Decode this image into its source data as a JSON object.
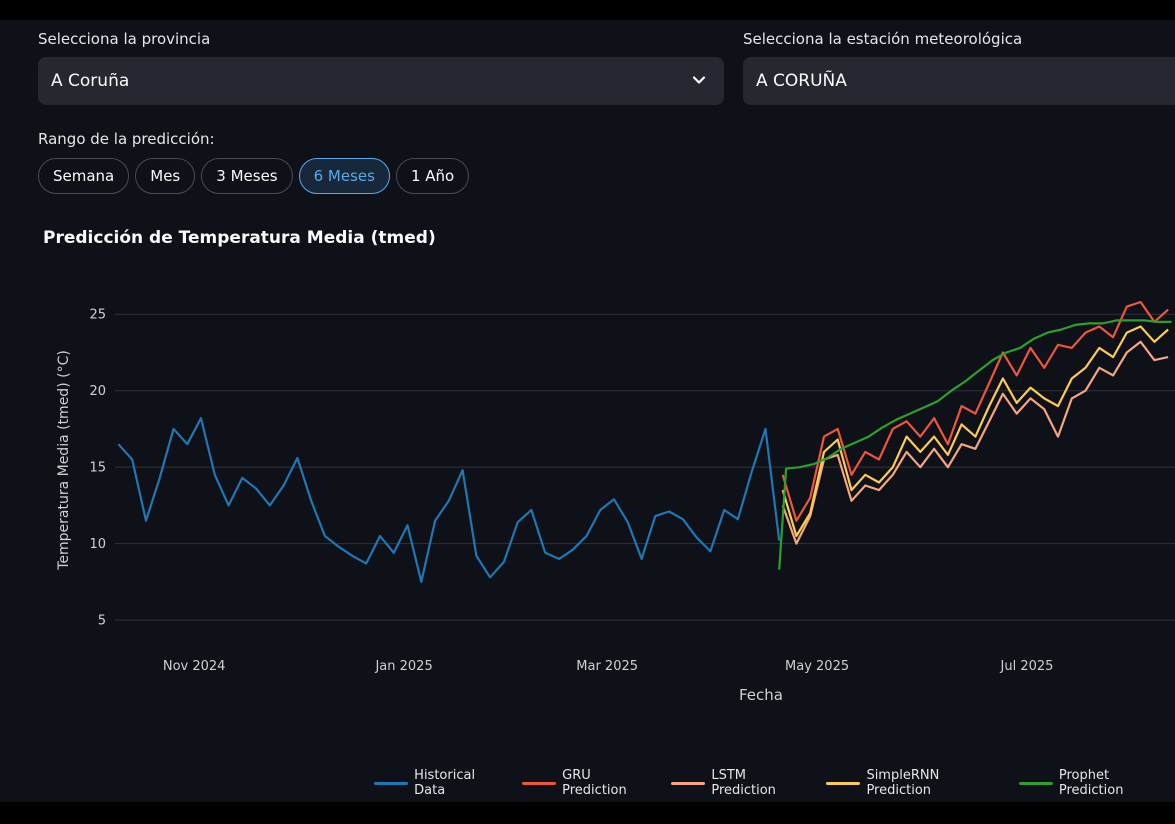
{
  "form": {
    "province_label": "Selecciona la provincia",
    "province_value": "A Coruña",
    "station_label": "Selecciona la estación meteorológica",
    "station_value": "A CORUÑA",
    "range_label": "Rango de la predicción:",
    "range_options": [
      "Semana",
      "Mes",
      "3 Meses",
      "6 Meses",
      "1 Año"
    ],
    "range_selected": "6 Meses"
  },
  "chart_data": {
    "type": "line",
    "title": "Predicción de Temperatura Media (tmed)",
    "xlabel": "Fecha",
    "ylabel": "Temperatura Media (tmed) (°C)",
    "ylim": [
      3.7,
      27.5
    ],
    "xlim": [
      "2024-10-09",
      "2025-08-13"
    ],
    "yticks": [
      5,
      10,
      15,
      20,
      25
    ],
    "xticks": [
      {
        "date": "2024-11-01",
        "label": "Nov 2024"
      },
      {
        "date": "2025-01-01",
        "label": "Jan 2025"
      },
      {
        "date": "2025-03-01",
        "label": "Mar 2025"
      },
      {
        "date": "2025-05-01",
        "label": "May 2025"
      },
      {
        "date": "2025-07-01",
        "label": "Jul 2025"
      }
    ],
    "grid": true,
    "legend_position": "bottom",
    "series": [
      {
        "name": "Historical Data",
        "color": "#1f77b4",
        "x": [
          "2024-10-10",
          "2024-10-14",
          "2024-10-18",
          "2024-10-22",
          "2024-10-26",
          "2024-10-30",
          "2024-11-03",
          "2024-11-07",
          "2024-11-11",
          "2024-11-15",
          "2024-11-19",
          "2024-11-23",
          "2024-11-27",
          "2024-12-01",
          "2024-12-05",
          "2024-12-09",
          "2024-12-13",
          "2024-12-17",
          "2024-12-21",
          "2024-12-25",
          "2024-12-29",
          "2025-01-02",
          "2025-01-06",
          "2025-01-10",
          "2025-01-14",
          "2025-01-18",
          "2025-01-22",
          "2025-01-26",
          "2025-01-30",
          "2025-02-03",
          "2025-02-07",
          "2025-02-11",
          "2025-02-15",
          "2025-02-19",
          "2025-02-23",
          "2025-02-27",
          "2025-03-03",
          "2025-03-07",
          "2025-03-11",
          "2025-03-15",
          "2025-03-19",
          "2025-03-23",
          "2025-03-27",
          "2025-03-31",
          "2025-04-04",
          "2025-04-08",
          "2025-04-12",
          "2025-04-16",
          "2025-04-20"
        ],
        "values": [
          16.5,
          15.5,
          11.5,
          14.3,
          17.5,
          16.5,
          18.2,
          14.5,
          12.5,
          14.3,
          13.6,
          12.5,
          13.8,
          15.6,
          12.8,
          10.5,
          9.8,
          9.2,
          8.7,
          10.5,
          9.4,
          11.2,
          7.5,
          11.5,
          12.8,
          14.8,
          9.2,
          7.8,
          8.8,
          11.4,
          12.2,
          9.4,
          9.0,
          9.6,
          10.5,
          12.2,
          12.9,
          11.4,
          9.0,
          11.8,
          12.1,
          11.6,
          10.4,
          9.5,
          12.2,
          11.6,
          14.7,
          17.5,
          10.2
        ]
      },
      {
        "name": "GRU Prediction",
        "color": "#ef553b",
        "x": [
          "2025-04-21",
          "2025-04-25",
          "2025-04-29",
          "2025-05-03",
          "2025-05-07",
          "2025-05-11",
          "2025-05-15",
          "2025-05-19",
          "2025-05-23",
          "2025-05-27",
          "2025-05-31",
          "2025-06-04",
          "2025-06-08",
          "2025-06-12",
          "2025-06-16",
          "2025-06-20",
          "2025-06-24",
          "2025-06-28",
          "2025-07-02",
          "2025-07-06",
          "2025-07-10",
          "2025-07-14",
          "2025-07-18",
          "2025-07-22",
          "2025-07-26",
          "2025-07-30",
          "2025-08-03",
          "2025-08-07",
          "2025-08-11"
        ],
        "values": [
          14.5,
          11.5,
          13.0,
          17.0,
          17.5,
          14.5,
          16.0,
          15.5,
          17.5,
          18.0,
          17.0,
          18.2,
          16.5,
          19.0,
          18.5,
          20.5,
          22.5,
          21.0,
          22.8,
          21.5,
          23.0,
          22.8,
          23.8,
          24.2,
          23.5,
          25.5,
          25.8,
          24.5,
          25.3
        ]
      },
      {
        "name": "LSTM Prediction",
        "color": "#f4a582",
        "x": [
          "2025-04-21",
          "2025-04-25",
          "2025-04-29",
          "2025-05-03",
          "2025-05-07",
          "2025-05-11",
          "2025-05-15",
          "2025-05-19",
          "2025-05-23",
          "2025-05-27",
          "2025-05-31",
          "2025-06-04",
          "2025-06-08",
          "2025-06-12",
          "2025-06-16",
          "2025-06-20",
          "2025-06-24",
          "2025-06-28",
          "2025-07-02",
          "2025-07-06",
          "2025-07-10",
          "2025-07-14",
          "2025-07-18",
          "2025-07-22",
          "2025-07-26",
          "2025-07-30",
          "2025-08-03",
          "2025-08-07",
          "2025-08-11"
        ],
        "values": [
          12.5,
          10.0,
          11.8,
          15.5,
          15.8,
          12.8,
          13.8,
          13.5,
          14.5,
          16.0,
          15.0,
          16.2,
          15.0,
          16.5,
          16.2,
          18.0,
          19.8,
          18.5,
          19.5,
          18.8,
          17.0,
          19.5,
          20.0,
          21.5,
          21.0,
          22.5,
          23.2,
          22.0,
          22.2
        ]
      },
      {
        "name": "SimpleRNN Prediction",
        "color": "#fecb52",
        "x": [
          "2025-04-21",
          "2025-04-25",
          "2025-04-29",
          "2025-05-03",
          "2025-05-07",
          "2025-05-11",
          "2025-05-15",
          "2025-05-19",
          "2025-05-23",
          "2025-05-27",
          "2025-05-31",
          "2025-06-04",
          "2025-06-08",
          "2025-06-12",
          "2025-06-16",
          "2025-06-20",
          "2025-06-24",
          "2025-06-28",
          "2025-07-02",
          "2025-07-06",
          "2025-07-10",
          "2025-07-14",
          "2025-07-18",
          "2025-07-22",
          "2025-07-26",
          "2025-07-30",
          "2025-08-03",
          "2025-08-07",
          "2025-08-11"
        ],
        "values": [
          13.5,
          10.5,
          12.0,
          16.0,
          16.8,
          13.5,
          14.5,
          14.0,
          15.0,
          17.0,
          16.0,
          17.0,
          15.8,
          17.8,
          17.0,
          19.0,
          20.8,
          19.2,
          20.2,
          19.5,
          19.0,
          20.8,
          21.5,
          22.8,
          22.2,
          23.8,
          24.2,
          23.2,
          24.0
        ]
      },
      {
        "name": "Prophet Prediction",
        "color": "#2ca02c",
        "x": [
          "2025-04-20",
          "2025-04-22",
          "2025-04-26",
          "2025-04-30",
          "2025-05-04",
          "2025-05-08",
          "2025-05-12",
          "2025-05-16",
          "2025-05-20",
          "2025-05-24",
          "2025-05-28",
          "2025-06-01",
          "2025-06-05",
          "2025-06-09",
          "2025-06-13",
          "2025-06-17",
          "2025-06-21",
          "2025-06-25",
          "2025-06-29",
          "2025-07-03",
          "2025-07-07",
          "2025-07-11",
          "2025-07-15",
          "2025-07-19",
          "2025-07-23",
          "2025-07-27",
          "2025-07-31",
          "2025-08-04",
          "2025-08-08",
          "2025-08-12"
        ],
        "values": [
          8.3,
          14.9,
          15.0,
          15.2,
          15.6,
          16.2,
          16.6,
          17.0,
          17.6,
          18.1,
          18.5,
          18.9,
          19.3,
          20.0,
          20.6,
          21.3,
          22.0,
          22.5,
          22.8,
          23.4,
          23.8,
          24.0,
          24.3,
          24.4,
          24.4,
          24.6,
          24.6,
          24.6,
          24.5,
          24.5
        ]
      }
    ]
  }
}
